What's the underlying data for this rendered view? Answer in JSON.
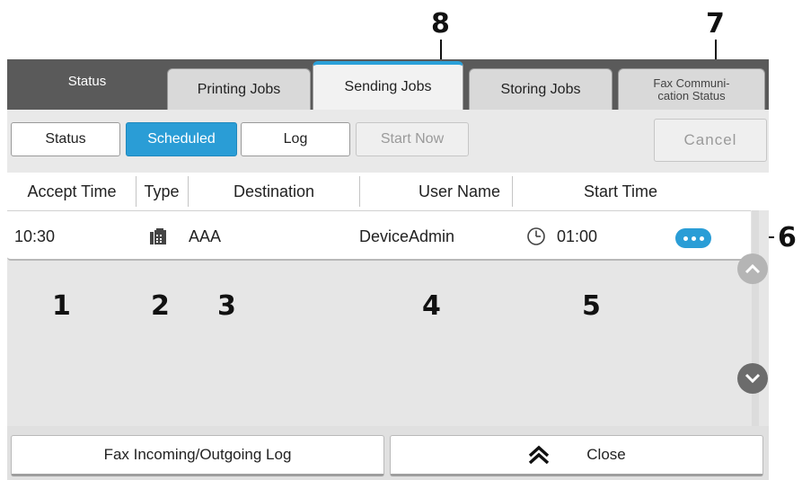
{
  "callouts": [
    "1",
    "2",
    "3",
    "4",
    "5",
    "6",
    "7",
    "8"
  ],
  "tabs": {
    "status": "Status",
    "printing": "Printing Jobs",
    "sending": "Sending Jobs",
    "storing": "Storing Jobs",
    "fax_line1": "Fax Communi-",
    "fax_line2": "cation Status"
  },
  "toolbar": {
    "status": "Status",
    "scheduled": "Scheduled",
    "log": "Log",
    "start_now": "Start Now",
    "cancel": "Cancel"
  },
  "columns": [
    "Accept Time",
    "Type",
    "Destination",
    "User Name",
    "Start Time"
  ],
  "job": {
    "accept_time": "10:30",
    "type_icon": "fax-icon",
    "destination": "AAA",
    "user_name": "DeviceAdmin",
    "start_icon": "clock-icon",
    "start_time": "01:00"
  },
  "bottom": {
    "fax_log": "Fax Incoming/Outgoing Log",
    "close": "Close"
  },
  "colors": {
    "accent": "#2a9dd6",
    "tab_bar": "#5a5a5a"
  }
}
